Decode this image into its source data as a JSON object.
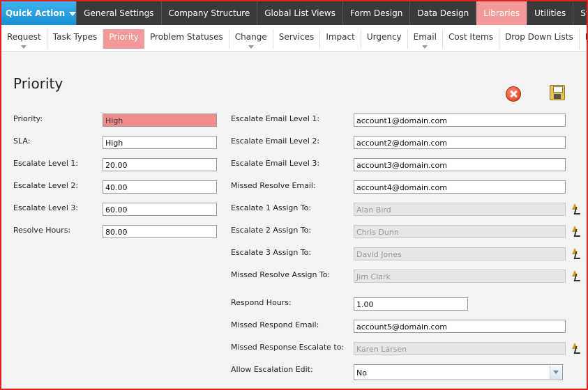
{
  "top_nav": {
    "quick_action": "Quick Action",
    "items": [
      "General Settings",
      "Company Structure",
      "Global List Views",
      "Form Design",
      "Data Design",
      "Libraries",
      "Utilities",
      "System Set"
    ]
  },
  "sub_nav": {
    "items": [
      "Request",
      "Task Types",
      "Priority",
      "Problem Statuses",
      "Change",
      "Services",
      "Impact",
      "Urgency",
      "Email",
      "Cost Items",
      "Drop Down Lists",
      "Brands"
    ]
  },
  "page": {
    "title": "Priority"
  },
  "left_form": [
    {
      "label": "Priority:",
      "value": "High"
    },
    {
      "label": "SLA:",
      "value": "High"
    },
    {
      "label": "Escalate Level 1:",
      "value": "20.00"
    },
    {
      "label": "Escalate Level 2:",
      "value": "40.00"
    },
    {
      "label": "Escalate Level 3:",
      "value": "60.00"
    },
    {
      "label": "Resolve Hours:",
      "value": "80.00"
    }
  ],
  "right_form": [
    {
      "label": "Escalate Email Level 1:",
      "value": "account1@domain.com"
    },
    {
      "label": "Escalate Email Level 2:",
      "value": "account2@domain.com"
    },
    {
      "label": "Escalate Email Level 3:",
      "value": "account3@domain.com"
    },
    {
      "label": "Missed Resolve Email:",
      "value": "account4@domain.com"
    },
    {
      "label": "Escalate 1 Assign To:",
      "value": "Alan Bird"
    },
    {
      "label": "Escalate 2 Assign To:",
      "value": "Chris Dunn"
    },
    {
      "label": "Escalate 3 Assign To:",
      "value": "David Jones"
    },
    {
      "label": "Missed Resolve Assign To:",
      "value": "Jim Clark"
    },
    {
      "label": "Respond Hours:",
      "value": "1.00"
    },
    {
      "label": "Missed Respond Email:",
      "value": "account5@domain.com"
    },
    {
      "label": "Missed Response Escalate to:",
      "value": "Karen Larsen"
    },
    {
      "label": "Allow Escalation Edit:",
      "value": "No"
    }
  ],
  "icons": {
    "cancel": "cancel-icon",
    "save": "save-icon",
    "picker": "user-picker-icon"
  },
  "colors": {
    "accent_active": "#f29a9a",
    "highlight_field": "#f28b8b",
    "quick_action": "#1a8fd2",
    "top_nav_bg": "#3a3a3a"
  }
}
